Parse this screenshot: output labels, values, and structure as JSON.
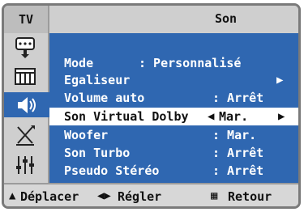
{
  "header": {
    "source_label": "TV",
    "title": "Son"
  },
  "sidebar": {
    "items": [
      {
        "icon": "input-source-icon"
      },
      {
        "icon": "picture-icon"
      },
      {
        "icon": "sound-icon",
        "active": true
      },
      {
        "icon": "channel-antenna-icon"
      },
      {
        "icon": "setup-sliders-icon"
      }
    ]
  },
  "menu": {
    "rows": [
      {
        "label": "Mode",
        "value": ": Personnalisé"
      },
      {
        "label": "Egaliseur",
        "value": ""
      },
      {
        "label": "Volume auto",
        "value": ": Arrêt"
      },
      {
        "label": "Son Virtual Dolby",
        "value": "Mar.",
        "selected": true
      },
      {
        "label": "Woofer",
        "value": ": Mar."
      },
      {
        "label": "Son Turbo",
        "value": ": Arrêt"
      },
      {
        "label": "Pseudo Stéréo",
        "value": ": Arrêt"
      }
    ]
  },
  "footer": {
    "move": "Déplacer",
    "adjust": "Régler",
    "back": "Retour"
  },
  "colors": {
    "menu_bg": "#2f67b1",
    "panel_bg": "#d7d7d7",
    "border": "#7a7a7a"
  }
}
